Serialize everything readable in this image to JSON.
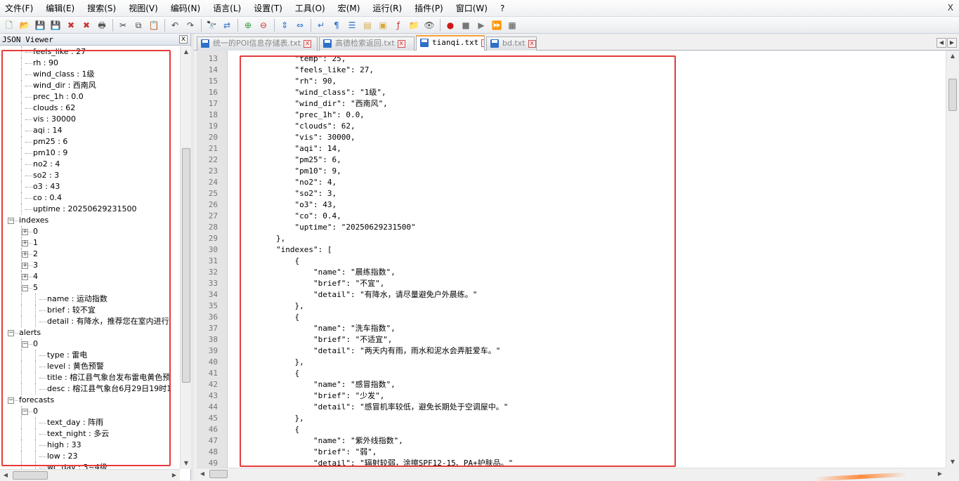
{
  "menu": [
    "文件(F)",
    "编辑(E)",
    "搜索(S)",
    "视图(V)",
    "编码(N)",
    "语言(L)",
    "设置(T)",
    "工具(O)",
    "宏(M)",
    "运行(R)",
    "插件(P)",
    "窗口(W)",
    "?"
  ],
  "menu_close": "X",
  "toolbar_icons": [
    {
      "name": "new-file-icon",
      "glyph": "🗋",
      "color": "#3b7d2f"
    },
    {
      "name": "open-file-icon",
      "glyph": "📂",
      "color": "#d6a93a"
    },
    {
      "name": "save-icon",
      "glyph": "💾",
      "color": "#2e6fc9"
    },
    {
      "name": "save-all-icon",
      "glyph": "💾",
      "color": "#2e6fc9"
    },
    {
      "name": "close-icon",
      "glyph": "✖",
      "color": "#c33"
    },
    {
      "name": "close-all-icon",
      "glyph": "✖",
      "color": "#c33"
    },
    {
      "name": "print-icon",
      "glyph": "🖶",
      "color": "#555"
    },
    {
      "name": "sep"
    },
    {
      "name": "cut-icon",
      "glyph": "✂",
      "color": "#444"
    },
    {
      "name": "copy-icon",
      "glyph": "⧉",
      "color": "#444"
    },
    {
      "name": "paste-icon",
      "glyph": "📋",
      "color": "#a57a2a"
    },
    {
      "name": "sep"
    },
    {
      "name": "undo-icon",
      "glyph": "↶",
      "color": "#444"
    },
    {
      "name": "redo-icon",
      "glyph": "↷",
      "color": "#444"
    },
    {
      "name": "sep"
    },
    {
      "name": "find-icon",
      "glyph": "🔭",
      "color": "#333"
    },
    {
      "name": "replace-icon",
      "glyph": "⇄",
      "color": "#2e6fc9"
    },
    {
      "name": "sep"
    },
    {
      "name": "zoom-in-icon",
      "glyph": "⊕",
      "color": "#2a9a3a"
    },
    {
      "name": "zoom-out-icon",
      "glyph": "⊖",
      "color": "#c33"
    },
    {
      "name": "sep"
    },
    {
      "name": "sync-vertical-icon",
      "glyph": "⇕",
      "color": "#2e6fc9"
    },
    {
      "name": "sync-horizontal-icon",
      "glyph": "⇔",
      "color": "#2e6fc9"
    },
    {
      "name": "sep"
    },
    {
      "name": "word-wrap-icon",
      "glyph": "↵",
      "color": "#2e6fc9"
    },
    {
      "name": "show-all-chars-icon",
      "glyph": "¶",
      "color": "#2e6fc9"
    },
    {
      "name": "indent-guide-icon",
      "glyph": "☰",
      "color": "#2e6fc9"
    },
    {
      "name": "udl-icon",
      "glyph": "▤",
      "color": "#d6a93a"
    },
    {
      "name": "doc-map-icon",
      "glyph": "▣",
      "color": "#d6a93a"
    },
    {
      "name": "function-list-icon",
      "glyph": "ƒ",
      "color": "#c33"
    },
    {
      "name": "folder-workspace-icon",
      "glyph": "📁",
      "color": "#d6a93a"
    },
    {
      "name": "monitor-icon",
      "glyph": "👁",
      "color": "#555"
    },
    {
      "name": "sep"
    },
    {
      "name": "record-macro-icon",
      "glyph": "●",
      "color": "#d01818"
    },
    {
      "name": "stop-macro-icon",
      "glyph": "■",
      "color": "#777"
    },
    {
      "name": "play-macro-icon",
      "glyph": "▶",
      "color": "#777"
    },
    {
      "name": "run-macro-multiple-icon",
      "glyph": "⏩",
      "color": "#2e6fc9"
    },
    {
      "name": "save-macro-icon",
      "glyph": "▦",
      "color": "#555"
    }
  ],
  "panel": {
    "title": "JSON Viewer",
    "close": "x",
    "rows": [
      {
        "text": "feels_like : 27",
        "indent": 3
      },
      {
        "text": "rh : 90",
        "indent": 3
      },
      {
        "text": "wind_class : 1级",
        "indent": 3
      },
      {
        "text": "wind_dir : 西南风",
        "indent": 3
      },
      {
        "text": "prec_1h : 0.0",
        "indent": 3
      },
      {
        "text": "clouds : 62",
        "indent": 3
      },
      {
        "text": "vis : 30000",
        "indent": 3
      },
      {
        "text": "aqi : 14",
        "indent": 3
      },
      {
        "text": "pm25 : 6",
        "indent": 3
      },
      {
        "text": "pm10 : 9",
        "indent": 3
      },
      {
        "text": "no2 : 4",
        "indent": 3
      },
      {
        "text": "so2 : 3",
        "indent": 3
      },
      {
        "text": "o3 : 43",
        "indent": 3
      },
      {
        "text": "co : 0.4",
        "indent": 3
      },
      {
        "text": "uptime : 20250629231500",
        "indent": 3
      },
      {
        "text": "indexes",
        "indent": 2,
        "expander": "−"
      },
      {
        "text": "0",
        "indent": 3,
        "expander": "+"
      },
      {
        "text": "1",
        "indent": 3,
        "expander": "+"
      },
      {
        "text": "2",
        "indent": 3,
        "expander": "+"
      },
      {
        "text": "3",
        "indent": 3,
        "expander": "+"
      },
      {
        "text": "4",
        "indent": 3,
        "expander": "+"
      },
      {
        "text": "5",
        "indent": 3,
        "expander": "−"
      },
      {
        "text": "name : 运动指数",
        "indent": 4
      },
      {
        "text": "brief : 较不宜",
        "indent": 4
      },
      {
        "text": "detail : 有降水，推荐您在室内进行",
        "indent": 4
      },
      {
        "text": "alerts",
        "indent": 2,
        "expander": "−"
      },
      {
        "text": "0",
        "indent": 3,
        "expander": "−"
      },
      {
        "text": "type : 雷电",
        "indent": 4
      },
      {
        "text": "level : 黄色预警",
        "indent": 4
      },
      {
        "text": "title : 榕江县气象台发布雷电黄色预",
        "indent": 4
      },
      {
        "text": "desc : 榕江县气象台6月29日19时1",
        "indent": 4
      },
      {
        "text": "forecasts",
        "indent": 2,
        "expander": "−"
      },
      {
        "text": "0",
        "indent": 3,
        "expander": "−"
      },
      {
        "text": "text_day : 阵雨",
        "indent": 4
      },
      {
        "text": "text_night : 多云",
        "indent": 4
      },
      {
        "text": "high : 33",
        "indent": 4
      },
      {
        "text": "low : 23",
        "indent": 4
      },
      {
        "text": "wc_day : 3~4级",
        "indent": 4
      }
    ]
  },
  "tabs": [
    {
      "label": "统一的POI信息存储表.txt",
      "active": false
    },
    {
      "label": "高德检索返回.txt",
      "active": false
    },
    {
      "label": "tianqi.txt",
      "active": true
    },
    {
      "label": "bd.txt",
      "active": false
    }
  ],
  "tab_close": "x",
  "editor": {
    "lines": [
      {
        "n": "13",
        "text": "            \"temp\": 25,"
      },
      {
        "n": "14",
        "text": "            \"feels_like\": 27,"
      },
      {
        "n": "15",
        "text": "            \"rh\": 90,"
      },
      {
        "n": "16",
        "text": "            \"wind_class\": \"1级\","
      },
      {
        "n": "17",
        "text": "            \"wind_dir\": \"西南风\","
      },
      {
        "n": "18",
        "text": "            \"prec_1h\": 0.0,"
      },
      {
        "n": "19",
        "text": "            \"clouds\": 62,"
      },
      {
        "n": "20",
        "text": "            \"vis\": 30000,"
      },
      {
        "n": "21",
        "text": "            \"aqi\": 14,"
      },
      {
        "n": "22",
        "text": "            \"pm25\": 6,"
      },
      {
        "n": "23",
        "text": "            \"pm10\": 9,"
      },
      {
        "n": "24",
        "text": "            \"no2\": 4,"
      },
      {
        "n": "25",
        "text": "            \"so2\": 3,"
      },
      {
        "n": "26",
        "text": "            \"o3\": 43,"
      },
      {
        "n": "27",
        "text": "            \"co\": 0.4,"
      },
      {
        "n": "28",
        "text": "            \"uptime\": \"20250629231500\""
      },
      {
        "n": "29",
        "text": "        },"
      },
      {
        "n": "30",
        "text": "        \"indexes\": ["
      },
      {
        "n": "31",
        "text": "            {"
      },
      {
        "n": "32",
        "text": "                \"name\": \"晨练指数\","
      },
      {
        "n": "33",
        "text": "                \"brief\": \"不宜\","
      },
      {
        "n": "34",
        "text": "                \"detail\": \"有降水，请尽量避免户外晨练。\""
      },
      {
        "n": "35",
        "text": "            },"
      },
      {
        "n": "36",
        "text": "            {"
      },
      {
        "n": "37",
        "text": "                \"name\": \"洗车指数\","
      },
      {
        "n": "38",
        "text": "                \"brief\": \"不适宜\","
      },
      {
        "n": "39",
        "text": "                \"detail\": \"两天内有雨，雨水和泥水会弄脏爱车。\""
      },
      {
        "n": "40",
        "text": "            },"
      },
      {
        "n": "41",
        "text": "            {"
      },
      {
        "n": "42",
        "text": "                \"name\": \"感冒指数\","
      },
      {
        "n": "43",
        "text": "                \"brief\": \"少发\","
      },
      {
        "n": "44",
        "text": "                \"detail\": \"感冒机率较低，避免长期处于空调屋中。\""
      },
      {
        "n": "45",
        "text": "            },"
      },
      {
        "n": "46",
        "text": "            {"
      },
      {
        "n": "47",
        "text": "                \"name\": \"紫外线指数\","
      },
      {
        "n": "48",
        "text": "                \"brief\": \"弱\","
      },
      {
        "n": "49",
        "text": "                \"detail\": \"辐射较弱，涂擦SPF12-15、PA+护肤品。\""
      }
    ]
  },
  "colors": {
    "highlight": "#e53b3b",
    "active_tab_accent": "#f7a33a"
  }
}
